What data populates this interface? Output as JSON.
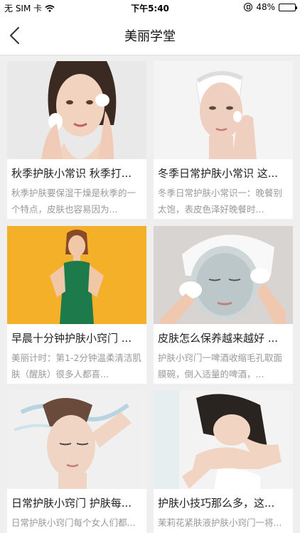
{
  "status_bar": {
    "carrier": "无 SIM 卡",
    "time": "下午5:40",
    "battery_percent": "48%",
    "battery_level": 0.48
  },
  "header": {
    "title": "美丽学堂",
    "back_icon": "chevron-left-icon"
  },
  "cards": [
    {
      "title": "秋季护肤小常识 秋季打...",
      "desc": "秋季护肤要保湿干燥是秋季的一个特点，皮肤也容易因为..."
    },
    {
      "title": "冬季日常护肤小常识 这...",
      "desc": "冬季日常护肤小常识一：晚餐别太饱，表皮色泽好晚餐时..."
    },
    {
      "title": "早晨十分钟护肤小窍门 ...",
      "desc": "美丽计时：第1-2分钟温柔清洁肌肤（醒肤）很多人都喜..."
    },
    {
      "title": "皮肤怎么保养越来越好 ...",
      "desc": "护肤小窍门一啤酒收缩毛孔取面膜碗，倒入适量的啤酒，..."
    },
    {
      "title": "日常护肤小窍门 护肤每...",
      "desc": "日常护肤小窍门每个女人们都..."
    },
    {
      "title": "护肤小技巧那么多，这...",
      "desc": "茉莉花紧肤液护肤小窍门一将..."
    }
  ]
}
